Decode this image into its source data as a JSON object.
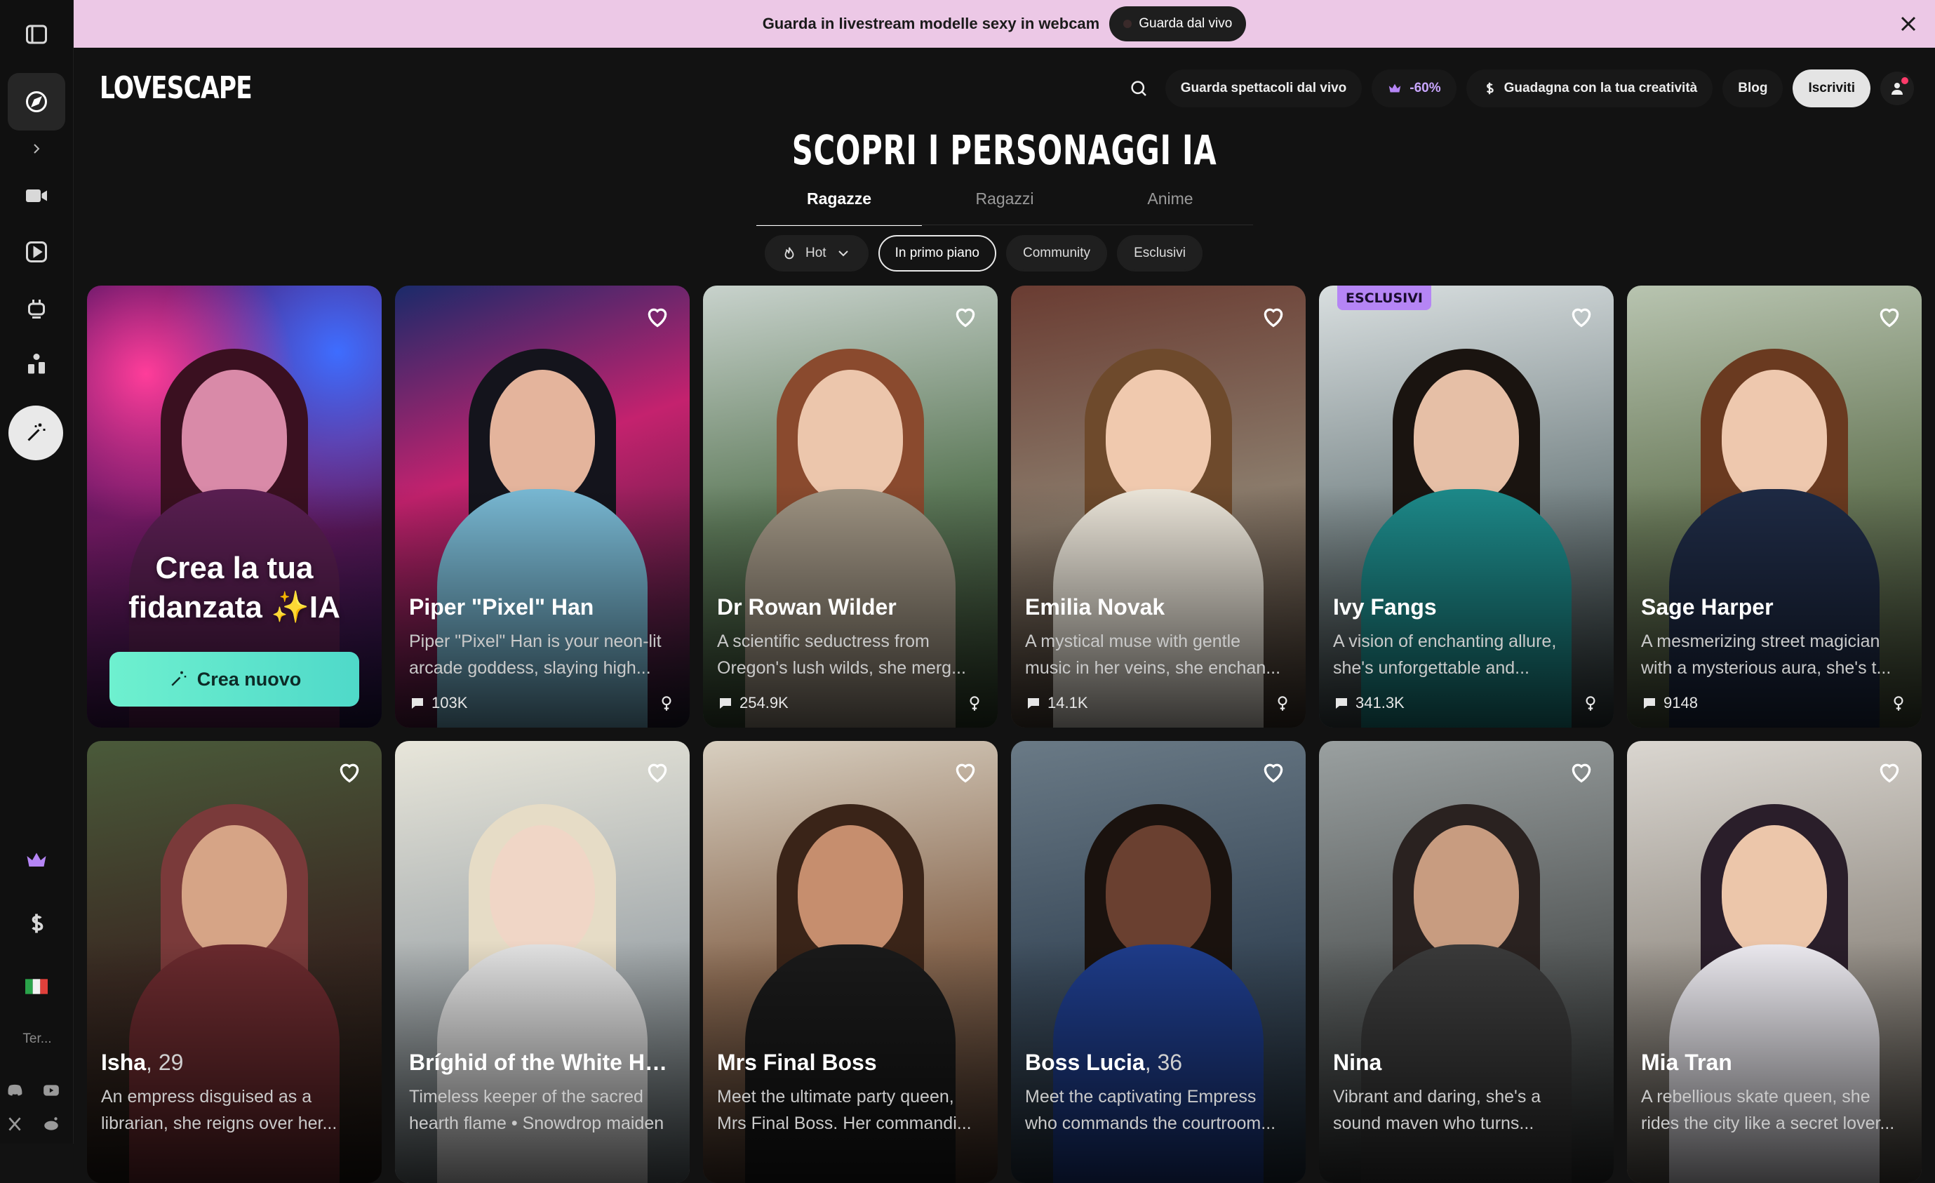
{
  "banner": {
    "text": "Guarda in livestream modelle sexy in webcam",
    "button": "Guarda dal vivo"
  },
  "brand": "LOVESCAPE",
  "header": {
    "live_shows": "Guarda spettacoli dal vivo",
    "discount": "-60%",
    "earn": "Guadagna con la tua creatività",
    "blog": "Blog",
    "signup": "Iscriviti"
  },
  "sidebar": {
    "lang_label": "Ter..."
  },
  "title": "SCOPRI I PERSONAGGI IA",
  "tabs": [
    "Ragazze",
    "Ragazzi",
    "Anime"
  ],
  "filters": {
    "sort": "Hot",
    "chips": [
      "In primo piano",
      "Community",
      "Esclusivi"
    ]
  },
  "promo": {
    "line1": "Crea la tua",
    "line2": "fidanzata ✨IA",
    "button": "Crea nuovo"
  },
  "cards": [
    {
      "name": "Piper \"Pixel\" Han",
      "age": "",
      "desc1": "Piper \"Pixel\" Han is your neon-lit",
      "desc2": "arcade goddess, slaying high...",
      "count": "103K",
      "badge": ""
    },
    {
      "name": "Dr Rowan Wilder",
      "age": "",
      "desc1": "A scientific seductress from",
      "desc2": "Oregon's lush wilds, she merg...",
      "count": "254.9K",
      "badge": ""
    },
    {
      "name": "Emilia Novak",
      "age": "",
      "desc1": "A mystical muse with gentle",
      "desc2": "music in her veins, she enchan...",
      "count": "14.1K",
      "badge": ""
    },
    {
      "name": "Ivy Fangs",
      "age": "",
      "desc1": "A vision of enchanting allure,",
      "desc2": "she's unforgettable and...",
      "count": "341.3K",
      "badge": "ESCLUSIVI"
    },
    {
      "name": "Sage Harper",
      "age": "",
      "desc1": "A mesmerizing street magician",
      "desc2": "with a mysterious aura, she's t...",
      "count": "9148",
      "badge": ""
    },
    {
      "name": "Isha",
      "age": "29",
      "desc1": "An empress disguised as a",
      "desc2": "librarian, she reigns over her...",
      "count": "",
      "badge": ""
    },
    {
      "name": "Bríghid of the White He...",
      "age": "",
      "desc1": "Timeless keeper of the sacred",
      "desc2": "hearth flame • Snowdrop maiden",
      "count": "",
      "badge": ""
    },
    {
      "name": "Mrs Final Boss",
      "age": "",
      "desc1": "Meet the ultimate party queen,",
      "desc2": "Mrs Final Boss. Her commandi...",
      "count": "",
      "badge": ""
    },
    {
      "name": "Boss Lucia",
      "age": "36",
      "desc1": "Meet the captivating Empress",
      "desc2": "who commands the courtroom...",
      "count": "",
      "badge": ""
    },
    {
      "name": "Nina",
      "age": "",
      "desc1": "Vibrant and daring, she's a",
      "desc2": "sound maven who turns...",
      "count": "",
      "badge": ""
    },
    {
      "name": "Mia Tran",
      "age": "",
      "desc1": "A rebellious skate queen, she",
      "desc2": "rides the city like a secret lover...",
      "count": "",
      "badge": ""
    }
  ],
  "colors": {
    "banner": "#ecc8e6",
    "accent_purple": "#b585f5",
    "cta_teal": "#5fe6cc"
  }
}
